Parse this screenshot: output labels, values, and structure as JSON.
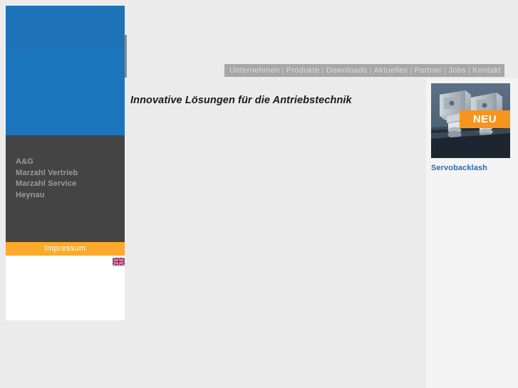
{
  "page": {
    "background_color": "#ebebeb",
    "right_column_color": "#f4f4f4"
  },
  "brand": {
    "block_color": "#1b75bc",
    "logo_alt": "company-logo"
  },
  "top_nav": {
    "background_color": "#a7a7a7",
    "text_color": "#dcdcdc",
    "separator": "|",
    "items": [
      {
        "label": "Unternehmen"
      },
      {
        "label": "Produkte"
      },
      {
        "label": "Downloads"
      },
      {
        "label": "Aktuelles"
      },
      {
        "label": "Partner"
      },
      {
        "label": "Jobs"
      },
      {
        "label": "Kontakt"
      }
    ]
  },
  "tagline": {
    "text": "Innovative Lösungen für die Antriebstechnik"
  },
  "sidebar": {
    "background_color": "#444444",
    "text_color": "#9b9b9b",
    "items": [
      {
        "label": "A&G"
      },
      {
        "label": "Marzahl Vertrieb"
      },
      {
        "label": "Marzahl Service"
      },
      {
        "label": "Heynau"
      }
    ],
    "impressum": {
      "label": "Impressum",
      "background_color": "#fbaa2c",
      "text_color": "#ffffff"
    },
    "language_switch": {
      "icon": "uk-flag-icon",
      "title": "English"
    }
  },
  "promo": {
    "image_alt": "servobacklash-product-photo",
    "badge": {
      "label": "NEU",
      "background_color": "#f7941d",
      "text_color": "#ffffff"
    },
    "caption": "Servobacklash",
    "caption_color": "#2b6cb5"
  }
}
